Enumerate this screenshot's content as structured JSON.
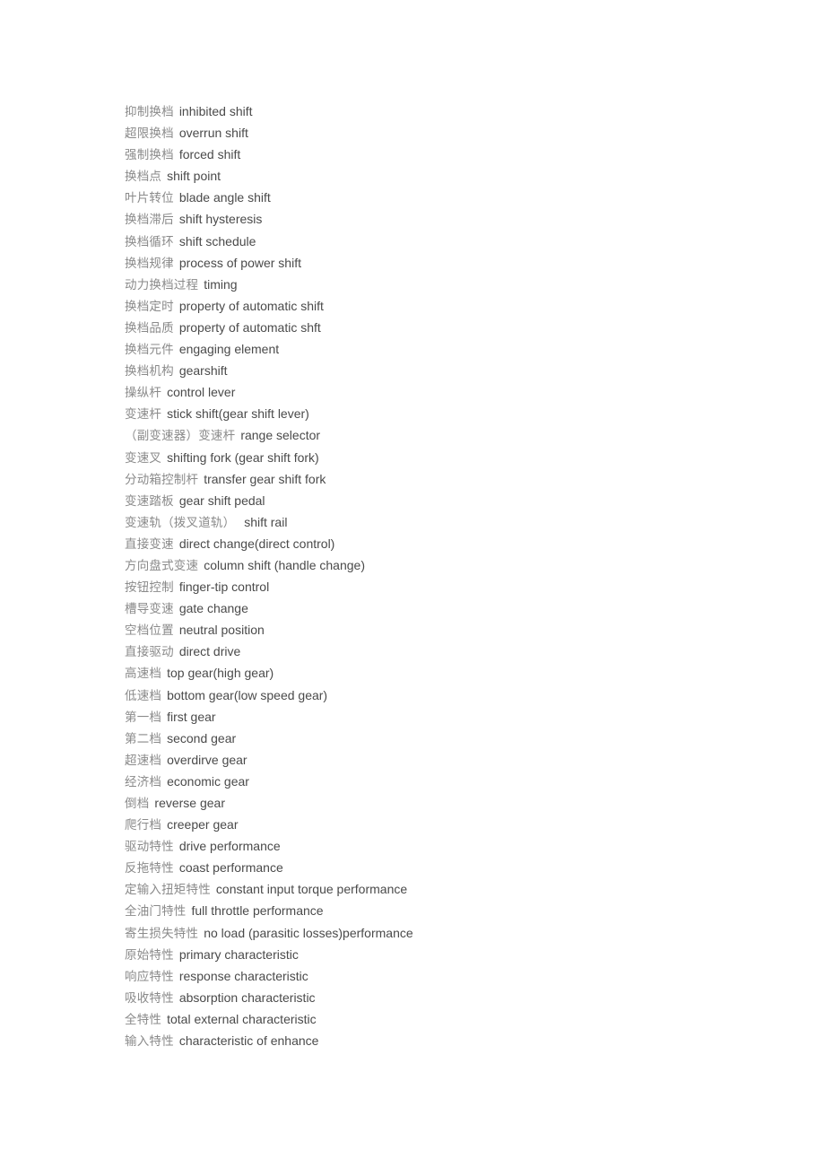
{
  "document": {
    "terms": [
      {
        "zh": "抑制换档",
        "en": "inhibited shift"
      },
      {
        "zh": "超限换档",
        "en": "overrun shift"
      },
      {
        "zh": "强制换档",
        "en": "forced shift"
      },
      {
        "zh": "换档点",
        "en": "shift point"
      },
      {
        "zh": "叶片转位",
        "en": "blade angle shift"
      },
      {
        "zh": "换档滞后",
        "en": "shift hysteresis"
      },
      {
        "zh": "换档循环",
        "en": "shift schedule"
      },
      {
        "zh": "换档规律",
        "en": "process of power shift"
      },
      {
        "zh": "动力换档过程",
        "en": "timing"
      },
      {
        "zh": "换档定时",
        "en": "property of automatic shift"
      },
      {
        "zh": "换档品质",
        "en": "property of automatic shft"
      },
      {
        "zh": "换档元件",
        "en": "engaging element"
      },
      {
        "zh": "换档机构",
        "en": "gearshift"
      },
      {
        "zh": "操纵杆",
        "en": "control lever"
      },
      {
        "zh": "变速杆",
        "en": "stick shift(gear shift lever)"
      },
      {
        "zh": "（副变速器）变速杆",
        "en": "range selector"
      },
      {
        "zh": "变速叉",
        "en": "shifting fork (gear shift fork)"
      },
      {
        "zh": "分动箱控制杆",
        "en": "transfer gear shift fork"
      },
      {
        "zh": "变速踏板",
        "en": "gear shift pedal"
      },
      {
        "zh": "变速轨（拨叉道轨）",
        "en": " shift rail"
      },
      {
        "zh": "直接变速",
        "en": "direct change(direct control)"
      },
      {
        "zh": "方向盘式变速",
        "en": "column shift (handle change)"
      },
      {
        "zh": "按钮控制",
        "en": "finger-tip control"
      },
      {
        "zh": "槽导变速",
        "en": "gate change"
      },
      {
        "zh": "空档位置",
        "en": "neutral position"
      },
      {
        "zh": "直接驱动",
        "en": "direct drive"
      },
      {
        "zh": "高速档",
        "en": "top gear(high gear)"
      },
      {
        "zh": "低速档",
        "en": "bottom gear(low speed gear)"
      },
      {
        "zh": "第一档",
        "en": "first gear"
      },
      {
        "zh": "第二档",
        "en": "second gear"
      },
      {
        "zh": "超速档",
        "en": "overdirve gear"
      },
      {
        "zh": "经济档",
        "en": "economic gear"
      },
      {
        "zh": "倒档",
        "en": "reverse gear"
      },
      {
        "zh": "爬行档",
        "en": "creeper gear"
      },
      {
        "zh": "驱动特性",
        "en": "drive performance"
      },
      {
        "zh": "反拖特性",
        "en": "coast performance"
      },
      {
        "zh": "定输入扭矩特性",
        "en": "constant input torque performance"
      },
      {
        "zh": "全油门特性",
        "en": "full throttle performance"
      },
      {
        "zh": "寄生损失特性",
        "en": "no load (parasitic losses)performance"
      },
      {
        "zh": "原始特性",
        "en": "primary characteristic"
      },
      {
        "zh": "响应特性",
        "en": "response characteristic"
      },
      {
        "zh": "吸收特性",
        "en": "absorption characteristic"
      },
      {
        "zh": "全特性",
        "en": "total external characteristic"
      },
      {
        "zh": "输入特性",
        "en": "characteristic of enhance"
      }
    ]
  }
}
